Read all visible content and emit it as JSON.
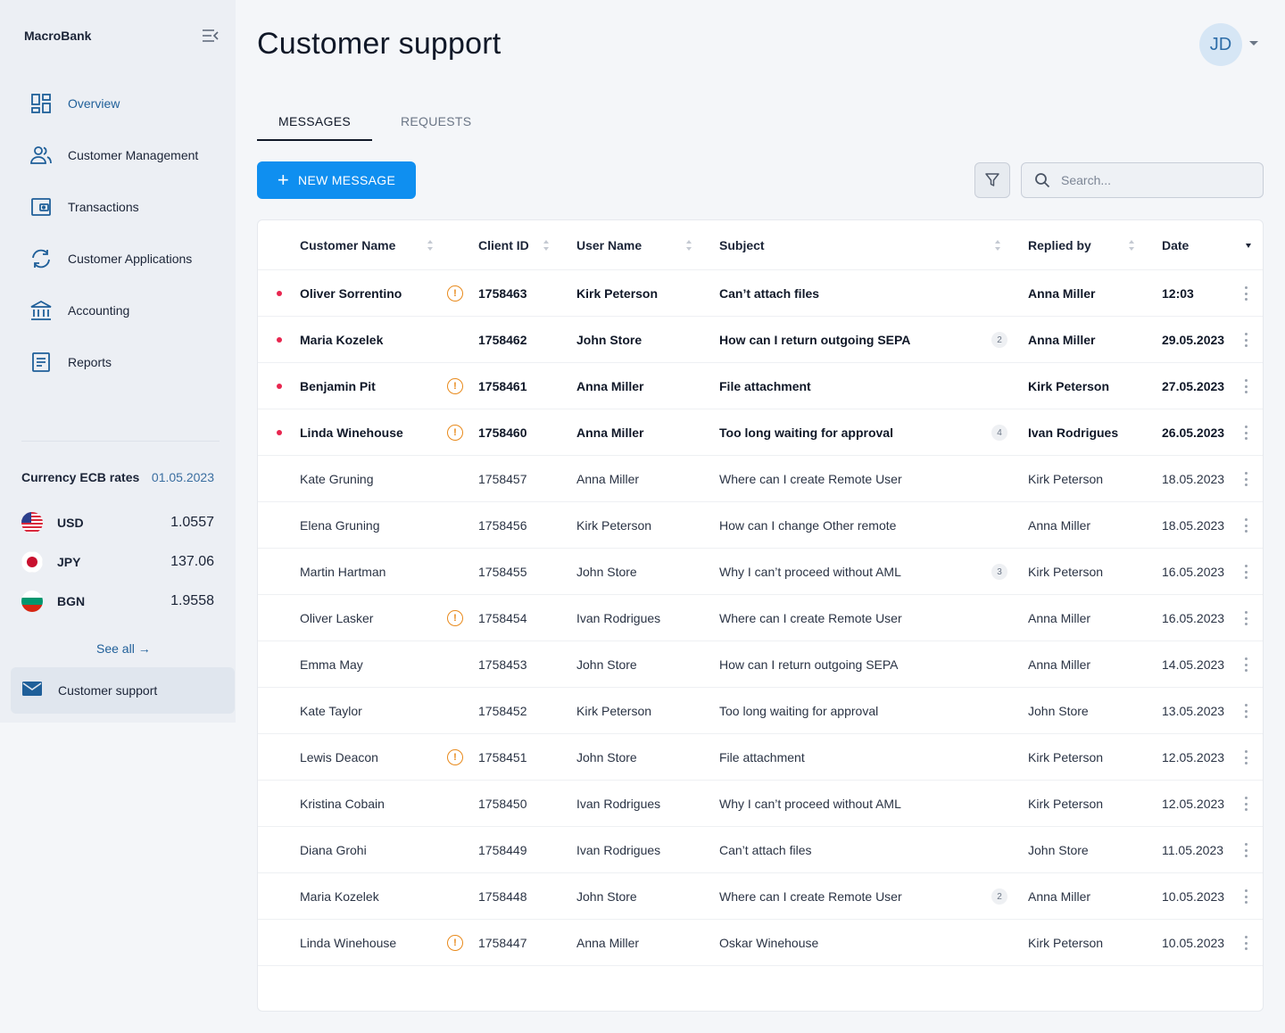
{
  "brand": "MacroBank",
  "nav": [
    {
      "label": "Overview",
      "icon": "dashboard-icon",
      "active": true
    },
    {
      "label": "Customer Management",
      "icon": "users-icon"
    },
    {
      "label": "Transactions",
      "icon": "wallet-icon"
    },
    {
      "label": "Customer Applications",
      "icon": "sync-icon"
    },
    {
      "label": "Accounting",
      "icon": "bank-icon"
    },
    {
      "label": "Reports",
      "icon": "document-icon"
    }
  ],
  "rates": {
    "title": "Currency ECB rates",
    "date": "01.05.2023",
    "items": [
      {
        "code": "USD",
        "value": "1.0557"
      },
      {
        "code": "JPY",
        "value": "137.06"
      },
      {
        "code": "BGN",
        "value": "1.9558"
      }
    ],
    "see_all": "See all →"
  },
  "support_item": "Customer support",
  "page_title": "Customer support",
  "avatar_initials": "JD",
  "tabs": [
    "MESSAGES",
    "REQUESTS"
  ],
  "new_message_label": "NEW MESSAGE",
  "search_placeholder": "Search...",
  "columns": [
    "Customer Name",
    "Client ID",
    "User Name",
    "Subject",
    "Replied by",
    "Date"
  ],
  "rows": [
    {
      "unread": true,
      "customer": "Oliver Sorrentino",
      "warn": true,
      "client_id": "1758463",
      "user": "Kirk Peterson",
      "subject": "Can’t attach files",
      "count": "",
      "replied_by": "Anna Miller",
      "date": "12:03"
    },
    {
      "unread": true,
      "customer": "Maria Kozelek",
      "warn": false,
      "client_id": "1758462",
      "user": "John Store",
      "subject": "How can I return outgoing SEPA",
      "count": "2",
      "replied_by": "Anna Miller",
      "date": "29.05.2023"
    },
    {
      "unread": true,
      "customer": "Benjamin Pit",
      "warn": true,
      "client_id": "1758461",
      "user": "Anna Miller",
      "subject": "File attachment",
      "count": "",
      "replied_by": "Kirk Peterson",
      "date": "27.05.2023"
    },
    {
      "unread": true,
      "customer": "Linda Winehouse",
      "warn": true,
      "client_id": "1758460",
      "user": "Anna Miller",
      "subject": "Too long waiting for approval",
      "count": "4",
      "replied_by": "Ivan Rodrigues",
      "date": "26.05.2023"
    },
    {
      "unread": false,
      "customer": "Kate Gruning",
      "warn": false,
      "client_id": "1758457",
      "user": "Anna Miller",
      "subject": "Where can I create Remote User",
      "count": "",
      "replied_by": "Kirk Peterson",
      "date": "18.05.2023"
    },
    {
      "unread": false,
      "customer": "Elena Gruning",
      "warn": false,
      "client_id": "1758456",
      "user": "Kirk Peterson",
      "subject": "How can I change Other remote",
      "count": "",
      "replied_by": "Anna Miller",
      "date": "18.05.2023"
    },
    {
      "unread": false,
      "customer": "Martin Hartman",
      "warn": false,
      "client_id": "1758455",
      "user": "John Store",
      "subject": "Why I can’t proceed without AML",
      "count": "3",
      "replied_by": "Kirk Peterson",
      "date": "16.05.2023"
    },
    {
      "unread": false,
      "customer": "Oliver Lasker",
      "warn": true,
      "client_id": "1758454",
      "user": "Ivan Rodrigues",
      "subject": "Where can I create Remote User",
      "count": "",
      "replied_by": "Anna Miller",
      "date": "16.05.2023"
    },
    {
      "unread": false,
      "customer": "Emma May",
      "warn": false,
      "client_id": "1758453",
      "user": "John Store",
      "subject": "How can I return outgoing SEPA",
      "count": "",
      "replied_by": "Anna Miller",
      "date": "14.05.2023"
    },
    {
      "unread": false,
      "customer": "Kate Taylor",
      "warn": false,
      "client_id": "1758452",
      "user": "Kirk Peterson",
      "subject": "Too long waiting for approval",
      "count": "",
      "replied_by": "John Store",
      "date": "13.05.2023"
    },
    {
      "unread": false,
      "customer": "Lewis Deacon",
      "warn": true,
      "client_id": "1758451",
      "user": "John Store",
      "subject": "File attachment",
      "count": "",
      "replied_by": "Kirk Peterson",
      "date": "12.05.2023"
    },
    {
      "unread": false,
      "customer": "Kristina Cobain",
      "warn": false,
      "client_id": "1758450",
      "user": "Ivan Rodrigues",
      "subject": "Why I can’t proceed without AML",
      "count": "",
      "replied_by": "Kirk Peterson",
      "date": "12.05.2023"
    },
    {
      "unread": false,
      "customer": "Diana Grohi",
      "warn": false,
      "client_id": "1758449",
      "user": "Ivan Rodrigues",
      "subject": "Can’t attach files",
      "count": "",
      "replied_by": "John Store",
      "date": "11.05.2023"
    },
    {
      "unread": false,
      "customer": "Maria Kozelek",
      "warn": false,
      "client_id": "1758448",
      "user": "John Store",
      "subject": "Where can I create Remote User",
      "count": "2",
      "replied_by": "Anna Miller",
      "date": "10.05.2023"
    },
    {
      "unread": false,
      "customer": "Linda Winehouse",
      "warn": true,
      "client_id": "1758447",
      "user": "Anna Miller",
      "subject": "Oskar Winehouse",
      "count": "",
      "replied_by": "Kirk Peterson",
      "date": "10.05.2023"
    }
  ],
  "colors": {
    "accent": "#0f8ff0",
    "unread_dot": "#e8264f",
    "warning": "#e8891a",
    "active_nav": "#1f5f99"
  }
}
